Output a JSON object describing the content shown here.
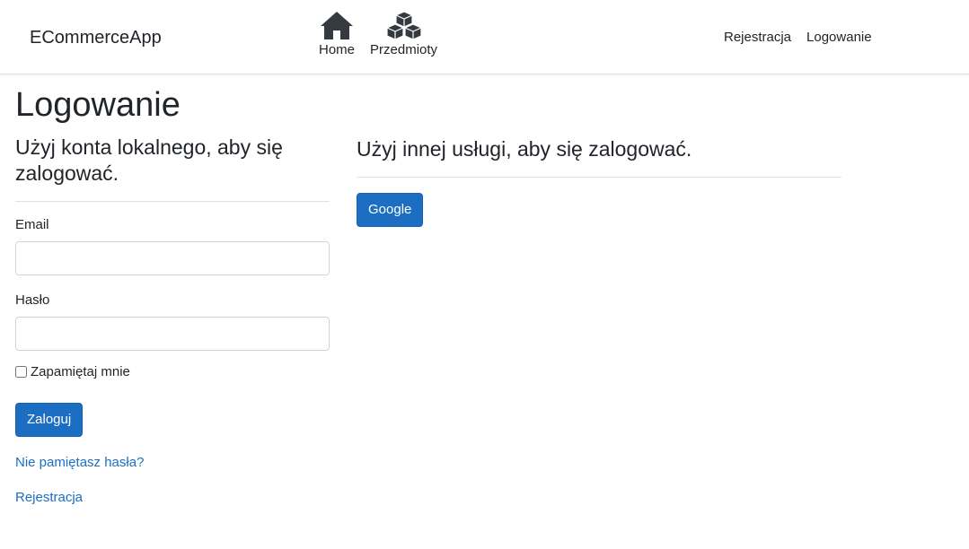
{
  "navbar": {
    "brand": "ECommerceApp",
    "center_items": [
      {
        "label": "Home",
        "icon": "home-icon"
      },
      {
        "label": "Przedmioty",
        "icon": "cubes-icon"
      }
    ],
    "right_items": [
      {
        "label": "Rejestracja"
      },
      {
        "label": "Logowanie"
      }
    ]
  },
  "page": {
    "title": "Logowanie"
  },
  "local_login": {
    "heading": "Użyj konta lokalnego, aby się zalogować.",
    "email_label": "Email",
    "email_value": "",
    "password_label": "Hasło",
    "password_value": "",
    "remember_label": "Zapamiętaj mnie",
    "remember_checked": false,
    "submit_label": "Zaloguj",
    "forgot_link": "Nie pamiętasz hasła?",
    "register_link": "Rejestracja"
  },
  "external_login": {
    "heading": "Użyj innej usługi, aby się zalogować.",
    "providers": [
      {
        "label": "Google"
      }
    ]
  },
  "colors": {
    "primary": "#1b6ec2",
    "text": "#212529",
    "border": "#dee2e6"
  }
}
